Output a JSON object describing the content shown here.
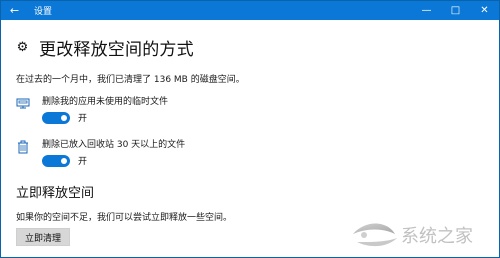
{
  "window": {
    "title": "设置"
  },
  "header": {
    "title": "更改释放空间的方式"
  },
  "summary": "在过去的一个月中，我们已清理了 136 MB 的磁盘空间。",
  "settings": [
    {
      "label": "删除我的应用未使用的临时文件",
      "state": "开"
    },
    {
      "label": "删除已放入回收站 30 天以上的文件",
      "state": "开"
    }
  ],
  "free_now": {
    "title": "立即释放空间",
    "description": "如果你的空间不足，我们可以尝试立即释放一些空间。",
    "button": "立即清理"
  },
  "watermark": {
    "text": "系统之家"
  },
  "colors": {
    "accent": "#0b78d7",
    "button_bg": "#d7d7d7"
  },
  "icons": {
    "back": "back-arrow-icon",
    "settings": "gear-icon",
    "temp_files": "monitor-icon",
    "recycle_bin": "trash-icon"
  }
}
